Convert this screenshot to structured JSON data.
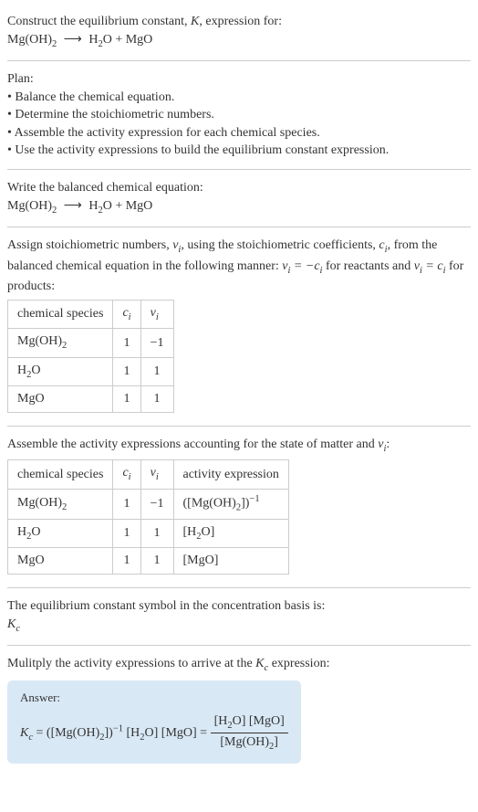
{
  "intro": {
    "line1": "Construct the equilibrium constant, ",
    "K": "K",
    "line1b": ", expression for:",
    "equation": "Mg(OH)₂ ⟶ H₂O + MgO"
  },
  "plan": {
    "heading": "Plan:",
    "items": [
      "Balance the chemical equation.",
      "Determine the stoichiometric numbers.",
      "Assemble the activity expression for each chemical species.",
      "Use the activity expressions to build the equilibrium constant expression."
    ]
  },
  "balanced": {
    "heading": "Write the balanced chemical equation:",
    "equation": "Mg(OH)₂ ⟶ H₂O + MgO"
  },
  "stoich": {
    "text1": "Assign stoichiometric numbers, ",
    "nu": "ν",
    "sub_i": "i",
    "text2": ", using the stoichiometric coefficients, ",
    "c": "c",
    "text3": ", from the balanced chemical equation in the following manner: ",
    "eq_reactants": "νᵢ = −cᵢ",
    "text4": " for reactants and ",
    "eq_products": "νᵢ = cᵢ",
    "text5": " for products:",
    "table": {
      "headers": [
        "chemical species",
        "cᵢ",
        "νᵢ"
      ],
      "rows": [
        [
          "Mg(OH)₂",
          "1",
          "−1"
        ],
        [
          "H₂O",
          "1",
          "1"
        ],
        [
          "MgO",
          "1",
          "1"
        ]
      ]
    }
  },
  "activity": {
    "text1": "Assemble the activity expressions accounting for the state of matter and ",
    "nu": "νᵢ",
    "text2": ":",
    "table": {
      "headers": [
        "chemical species",
        "cᵢ",
        "νᵢ",
        "activity expression"
      ],
      "rows": [
        [
          "Mg(OH)₂",
          "1",
          "−1",
          "([Mg(OH)₂])⁻¹"
        ],
        [
          "H₂O",
          "1",
          "1",
          "[H₂O]"
        ],
        [
          "MgO",
          "1",
          "1",
          "[MgO]"
        ]
      ]
    }
  },
  "symbol": {
    "text": "The equilibrium constant symbol in the concentration basis is:",
    "kc": "K",
    "kc_sub": "c"
  },
  "multiply": {
    "text1": "Mulitply the activity expressions to arrive at the ",
    "kc": "K",
    "kc_sub": "c",
    "text2": " expression:"
  },
  "answer": {
    "label": "Answer:",
    "lhs1": "K",
    "lhs1_sub": "c",
    "eq": " = ",
    "rhs1": "([Mg(OH)₂])⁻¹ [H₂O] [MgO] = ",
    "num": "[H₂O] [MgO]",
    "den": "[Mg(OH)₂]"
  }
}
